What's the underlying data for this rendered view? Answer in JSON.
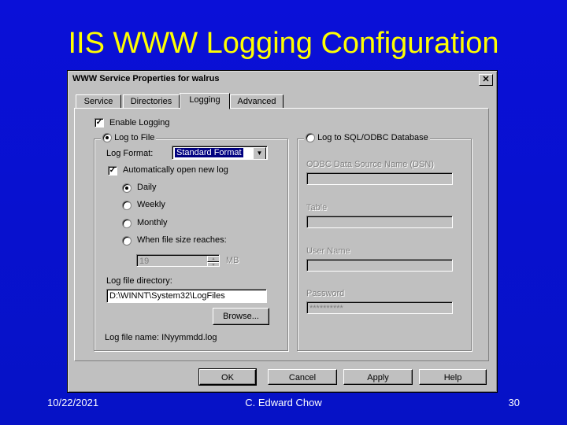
{
  "slide": {
    "title": "IIS WWW Logging Configuration",
    "date": "10/22/2021",
    "author": "C. Edward Chow",
    "page_number": "30"
  },
  "dialog": {
    "title": "WWW Service Properties for walrus",
    "close_glyph": "✕",
    "tabs": [
      {
        "label": "Service",
        "active": false
      },
      {
        "label": "Directories",
        "active": false
      },
      {
        "label": "Logging",
        "active": true
      },
      {
        "label": "Advanced",
        "active": false
      }
    ],
    "enable_logging": {
      "label": "Enable Logging",
      "checked": true
    },
    "log_to_file": {
      "label": "Log to File",
      "selected": true,
      "format_label": "Log Format:",
      "format_value": "Standard Format",
      "auto_open": {
        "label": "Automatically open new log",
        "checked": true
      },
      "schedule": [
        {
          "label": "Daily",
          "selected": true
        },
        {
          "label": "Weekly",
          "selected": false
        },
        {
          "label": "Monthly",
          "selected": false
        },
        {
          "label": "When file size reaches:",
          "selected": false
        }
      ],
      "file_size_value": "19",
      "file_size_unit": "MB",
      "directory_label": "Log file directory:",
      "directory_value": "D:\\WINNT\\System32\\LogFiles",
      "browse_label": "Browse...",
      "file_name_text": "Log file name: INyymmdd.log"
    },
    "log_to_sql": {
      "label": "Log to SQL/ODBC Database",
      "selected": false,
      "dsn_label": "ODBC Data Source Name (DSN)",
      "dsn_value": "",
      "table_label": "Table",
      "table_value": "",
      "user_label": "User Name",
      "user_value": "",
      "password_label": "Password",
      "password_value": "**********"
    },
    "buttons": {
      "ok": "OK",
      "cancel": "Cancel",
      "apply": "Apply",
      "help": "Help"
    }
  }
}
